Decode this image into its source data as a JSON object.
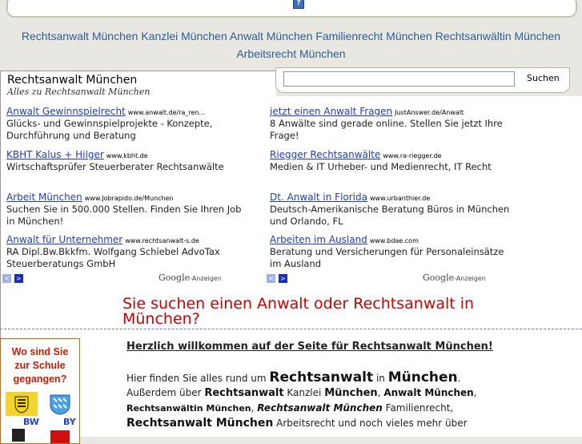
{
  "top": {
    "help_glyph": "?"
  },
  "keywords": [
    "Rechtsanwalt München",
    "Kanzlei München",
    "Anwalt München",
    "Familienrecht München",
    "Rechtsanwältin München",
    "Arbeitsrecht München"
  ],
  "header": {
    "title": "Rechtsanwalt München",
    "subtitle": "Alles zu Rechtsanwalt München"
  },
  "search": {
    "value": "",
    "button_label": "Suchen"
  },
  "ads_left": [
    {
      "title": "Anwalt Gewinnspielrecht",
      "url": "www.anwalt.de/ra_ren...",
      "desc": "Glücks- und Gewinnspielprojekte - Konzepte, Durchführung und Beratung"
    },
    {
      "title": "KBHT Kalus + Hilger",
      "url": "www.kbht.de",
      "desc": "Wirtschaftsprüfer Steuerberater Rechtsanwälte"
    },
    {
      "title": "Arbeit München",
      "url": "www.Jobrapido.de/Munchen",
      "desc": "Suchen Sie in 500.000 Stellen. Finden Sie Ihren Job in München!"
    },
    {
      "title": "Anwalt für Unternehmer",
      "url": "www.rechtsanwalt-s.de",
      "desc": "RA Dipl.Bw.Bkkfm. Wolfgang Schiebel AdvoTax Steuerberatungs GmbH"
    }
  ],
  "ads_right": [
    {
      "title": "jetzt einen Anwalt Fragen",
      "url": "JustAnswer.de/Anwalt",
      "desc": "8 Anwälte sind gerade online. Stellen Sie jetzt Ihre Frage!"
    },
    {
      "title": "Riegger Rechtsanwälte",
      "url": "www.ra-riegger.de",
      "desc": "Medien & IT Urheber- und Medienrecht, IT Recht"
    },
    {
      "title": "Dt. Anwalt in Florida",
      "url": "www.urbanthier.de",
      "desc": "Deutsch-Amerikanische Beratung Büros in München und Orlando, FL"
    },
    {
      "title": "Arbeiten im Ausland",
      "url": "www.bdae.com",
      "desc": "Beratung und Versicherungen für Personaleinsätze im Ausland"
    }
  ],
  "ad_footer": {
    "google": "Google",
    "suffix": "-Anzeigen",
    "prev": "<",
    "next": ">"
  },
  "headline": "Sie suchen einen Anwalt oder Rechtsanwalt in München?",
  "school": {
    "text": "Wo sind Sie zur Schule gegangen?",
    "bw": "BW",
    "by": "BY"
  },
  "welcome": "Herzlich willkommen auf der Seite für Rechtsanwalt München!",
  "intro": {
    "l1a": "Hier finden Sie alles rund um ",
    "l1b": "Rechtsanwalt",
    "l1c": " in ",
    "l1d": "München",
    "l1e": ".",
    "l2a": "Außerdem über ",
    "l2b": "Rechtsanwalt",
    "l2c": " Kanzlei ",
    "l2d": "München",
    "l2e": ", ",
    "l2f": "Anwalt München",
    "l2g": ",",
    "l3a": "Rechtsanwältin München",
    "l3b": ", ",
    "l3c": "Rechtsanwalt München",
    "l3d": " Familienrecht,",
    "l4a": "Rechtsanwalt München",
    "l4b": " Arbeitsrecht und noch vieles mehr über"
  },
  "colors": {
    "link_blue": "#1f3cc0",
    "headline_red": "#cc0000",
    "keyword_blue": "#2f5e92"
  }
}
